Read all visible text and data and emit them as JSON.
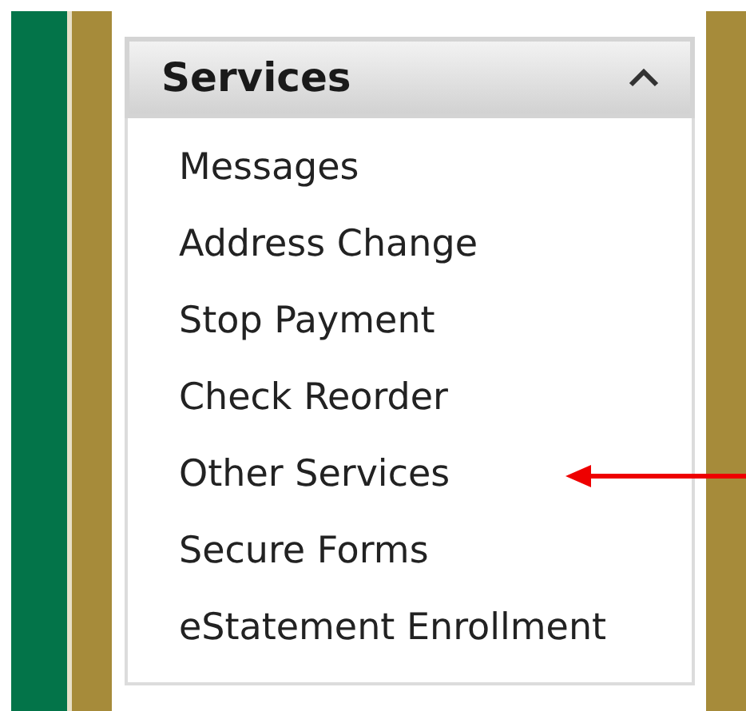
{
  "panel": {
    "title": "Services",
    "expanded": true,
    "items": [
      {
        "label": "Messages",
        "arrow": false
      },
      {
        "label": "Address Change",
        "arrow": false
      },
      {
        "label": "Stop Payment",
        "arrow": false
      },
      {
        "label": "Check Reorder",
        "arrow": false
      },
      {
        "label": "Other Services",
        "arrow": true
      },
      {
        "label": "Secure Forms",
        "arrow": false
      },
      {
        "label": "eStatement Enrollment",
        "arrow": false
      }
    ]
  }
}
